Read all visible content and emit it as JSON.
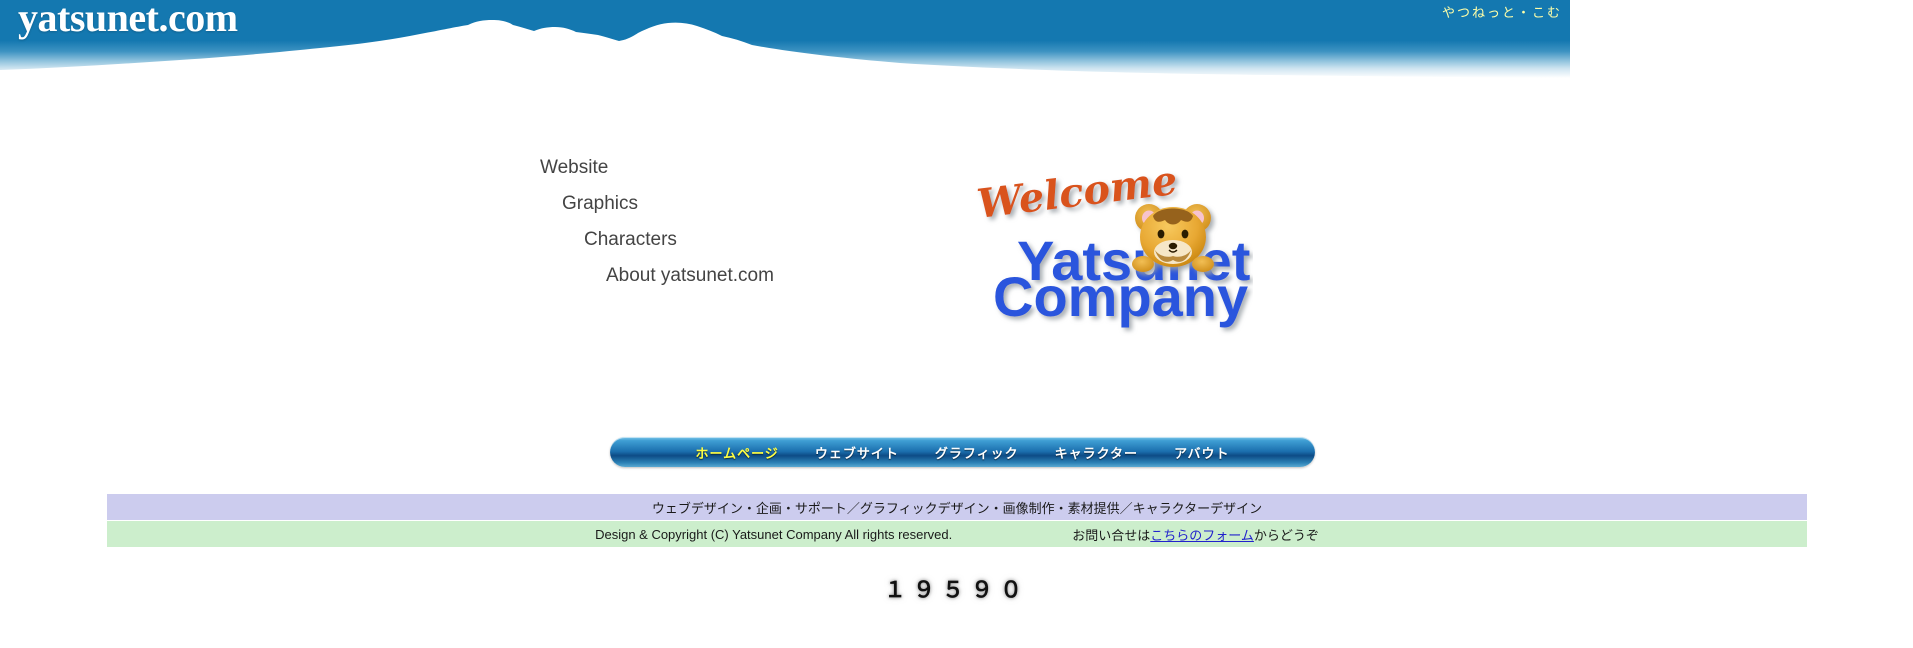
{
  "header": {
    "wordmark": "yatsunet.com",
    "kana_wordmark": "やつねっと・こむ",
    "banner_color": "#1478b0",
    "mountain_color": "#ffffff"
  },
  "text_menu": {
    "items": [
      {
        "label": "Website",
        "indent": 0
      },
      {
        "label": "Graphics",
        "indent": 1
      },
      {
        "label": "Characters",
        "indent": 2
      },
      {
        "label": "About yatsunet.com",
        "indent": 3
      }
    ]
  },
  "logo": {
    "welcome_text": "Welcome",
    "line1": "Yatsunet",
    "line2": "Company",
    "welcome_color": "#d9531e",
    "name_color": "#2a55dd",
    "mascot": "bear-mascot"
  },
  "nav": {
    "items": [
      {
        "label": "ホームページ",
        "active": true
      },
      {
        "label": "ウェブサイト",
        "active": false
      },
      {
        "label": "グラフィック",
        "active": false
      },
      {
        "label": "キャラクター",
        "active": false
      },
      {
        "label": "アバウト",
        "active": false
      }
    ],
    "active_color": "#ffff44",
    "inactive_color": "#ffffff"
  },
  "footer": {
    "services_text": "ウェブデザイン・企画・サポート／グラフィックデザイン・画像制作・素材提供／キャラクターデザイン",
    "services_band_color": "#ccccee",
    "copyright_text": "Design & Copyright (C) Yatsunet Company All rights reserved.",
    "contact_prefix": "お問い合せは",
    "contact_link_label": "こちらのフォーム",
    "contact_suffix": "からどうぞ",
    "copyright_band_color": "#cceecc",
    "link_color": "#2222cc"
  },
  "counter": {
    "value": "１９５９０"
  }
}
